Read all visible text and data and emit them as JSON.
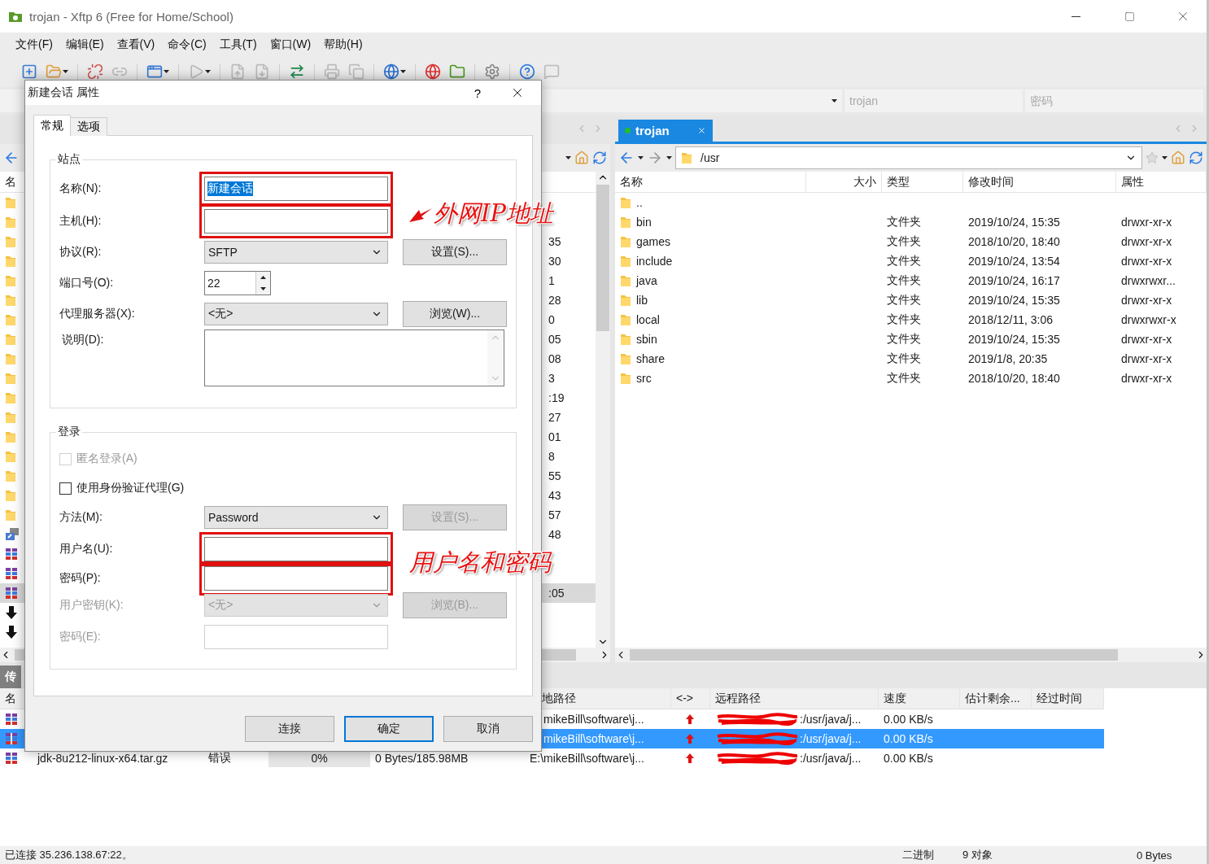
{
  "window": {
    "title": "trojan - Xftp 6 (Free for Home/School)"
  },
  "menu": [
    "文件(F)",
    "编辑(E)",
    "查看(V)",
    "命令(C)",
    "工具(T)",
    "窗口(W)",
    "帮助(H)"
  ],
  "quick_connect": {
    "user_placeholder": "trojan",
    "password_placeholder": "密码"
  },
  "left_pane": {
    "header": "名",
    "rows": [
      {
        "kind": "folder",
        "selected": false
      },
      {
        "kind": "folder",
        "selected": false
      },
      {
        "kind": "folder",
        "fragment": "35",
        "selected": false
      },
      {
        "kind": "folder",
        "fragment": "30",
        "selected": false
      },
      {
        "kind": "folder",
        "fragment": "1",
        "selected": false
      },
      {
        "kind": "folder",
        "fragment": "28",
        "selected": false
      },
      {
        "kind": "folder",
        "fragment": "0",
        "selected": false
      },
      {
        "kind": "folder",
        "fragment": "05",
        "selected": false
      },
      {
        "kind": "folder",
        "fragment": "08",
        "selected": false
      },
      {
        "kind": "folder",
        "fragment": "3",
        "selected": false
      },
      {
        "kind": "folder",
        "fragment": ":19",
        "selected": false
      },
      {
        "kind": "folder",
        "fragment": "27",
        "selected": false
      },
      {
        "kind": "folder",
        "fragment": "01",
        "selected": false
      },
      {
        "kind": "folder",
        "fragment": "8",
        "selected": false
      },
      {
        "kind": "folder",
        "fragment": "55",
        "selected": false
      },
      {
        "kind": "folder",
        "fragment": "43",
        "selected": false
      },
      {
        "kind": "folder",
        "fragment": "57",
        "selected": false
      },
      {
        "kind": "shortcut",
        "fragment": "48",
        "selected": false
      },
      {
        "kind": "archive",
        "selected": false
      },
      {
        "kind": "archive",
        "selected": false
      },
      {
        "kind": "archive",
        "fragment": ":05",
        "selected": true
      },
      {
        "kind": "download",
        "selected": false
      },
      {
        "kind": "download",
        "selected": false
      }
    ]
  },
  "right_pane": {
    "tab": {
      "label": "trojan",
      "selected": true,
      "connected": true
    },
    "path": "/usr",
    "columns": [
      "名称",
      "大小",
      "类型",
      "修改时间",
      "属性"
    ],
    "rows": [
      {
        "name": ".."
      },
      {
        "name": "bin",
        "type": "文件夹",
        "modified": "2019/10/24, 15:35",
        "attributes": "drwxr-xr-x"
      },
      {
        "name": "games",
        "type": "文件夹",
        "modified": "2018/10/20, 18:40",
        "attributes": "drwxr-xr-x"
      },
      {
        "name": "include",
        "type": "文件夹",
        "modified": "2019/10/24, 13:54",
        "attributes": "drwxr-xr-x"
      },
      {
        "name": "java",
        "type": "文件夹",
        "modified": "2019/10/24, 16:17",
        "attributes": "drwxrwxr..."
      },
      {
        "name": "lib",
        "type": "文件夹",
        "modified": "2019/10/24, 15:35",
        "attributes": "drwxr-xr-x"
      },
      {
        "name": "local",
        "type": "文件夹",
        "modified": "2018/12/11, 3:06",
        "attributes": "drwxrwxr-x"
      },
      {
        "name": "sbin",
        "type": "文件夹",
        "modified": "2019/10/24, 15:35",
        "attributes": "drwxr-xr-x"
      },
      {
        "name": "share",
        "type": "文件夹",
        "modified": "2019/1/8, 20:35",
        "attributes": "drwxr-xr-x"
      },
      {
        "name": "src",
        "type": "文件夹",
        "modified": "2018/10/20, 18:40",
        "attributes": "drwxr-xr-x"
      }
    ]
  },
  "transfers": {
    "tab": "传",
    "columns": {
      "name": "名",
      "local_path": "地路径",
      "direction": "<->",
      "remote_path": "远程路径",
      "speed": "速度",
      "eta": "估计剩余...",
      "elapsed": "经过时间"
    },
    "rows": [
      {
        "selected": false,
        "local_path": "mikeBill\\software\\j...",
        "remote_path": ":/usr/java/j...",
        "speed": "0.00 KB/s"
      },
      {
        "selected": true,
        "local_path": "mikeBill\\software\\j...",
        "remote_path": ":/usr/java/j...",
        "speed": "0.00 KB/s"
      },
      {
        "selected": false,
        "name": "jdk-8u212-linux-x64.tar.gz",
        "status": "错误",
        "progress": "0%",
        "level": 0,
        "size": "0 Bytes/185.98MB",
        "local_path": "E:\\mikeBill\\software\\j...",
        "remote_path": ":/usr/java/j...",
        "speed": "0.00 KB/s"
      }
    ]
  },
  "status_bar": {
    "connection": "已连接 35.236.138.67:22。",
    "mode": "二进制",
    "objects": "9 对象",
    "size": "0 Bytes"
  },
  "dialog": {
    "title": "新建会话 属性",
    "help": "?",
    "tabs": [
      {
        "label": "常规",
        "selected": true
      },
      {
        "label": "选项",
        "selected": false
      }
    ],
    "groups": [
      {
        "title": "站点",
        "rows": [
          {
            "kind": "text",
            "label": "名称(N):",
            "value": "新建会话",
            "value_selected": true,
            "annotated": true,
            "disabled": false
          },
          {
            "kind": "text",
            "label": "主机(H):",
            "annotated": true,
            "disabled": false
          },
          {
            "kind": "select",
            "label": "协议(R):",
            "value": "SFTP",
            "disabled": false,
            "button": {
              "label": "设置(S)...",
              "disabled": false
            }
          },
          {
            "kind": "spin",
            "label": "端口号(O):",
            "value": "22"
          },
          {
            "kind": "select",
            "label": "代理服务器(X):",
            "value": "<无>",
            "disabled": false,
            "button": {
              "label": "浏览(W)...",
              "disabled": false
            }
          },
          {
            "kind": "memo",
            "label": "说明(D):"
          }
        ]
      },
      {
        "title": "登录",
        "rows": [
          {
            "kind": "checkbox",
            "label": "匿名登录(A)",
            "checked": false,
            "disabled": true
          },
          {
            "kind": "checkbox",
            "label": "使用身份验证代理(G)",
            "checked": false,
            "disabled": false
          },
          {
            "kind": "select",
            "label": "方法(M):",
            "value": "Password",
            "disabled": false,
            "button": {
              "label": "设置(S)...",
              "disabled": true
            }
          },
          {
            "kind": "text",
            "label": "用户名(U):",
            "annotated": true,
            "disabled": false
          },
          {
            "kind": "password",
            "label": "密码(P):",
            "annotated": true,
            "disabled": false
          },
          {
            "kind": "select",
            "label": "用户密钥(K):",
            "value": "<无>",
            "disabled": true,
            "button": {
              "label": "浏览(B)...",
              "disabled": true
            }
          },
          {
            "kind": "password",
            "label": "密码(E):",
            "annotated": false,
            "disabled": true
          }
        ]
      }
    ],
    "buttons": [
      {
        "label": "连接",
        "default": false
      },
      {
        "label": "确定",
        "default": true
      },
      {
        "label": "取消",
        "default": false
      }
    ],
    "annotations": [
      {
        "text": "外网IP地址",
        "arrow": true
      },
      {
        "text": "用户名和密码",
        "arrow": false
      }
    ]
  }
}
